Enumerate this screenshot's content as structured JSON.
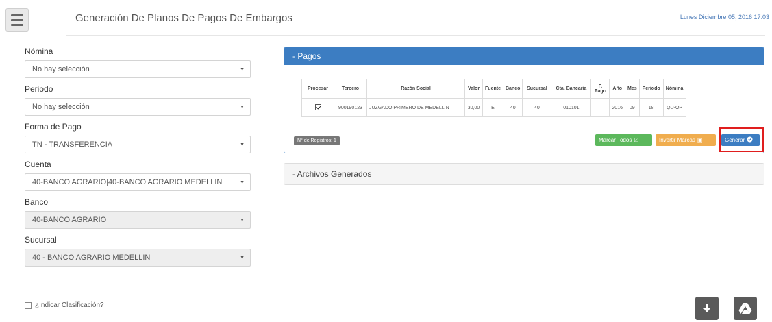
{
  "header": {
    "title": "Generación De Planos De Pagos De Embargos",
    "date": "Lunes Diciembre 05, 2016 17:03"
  },
  "form": {
    "nomina": {
      "label": "Nómina",
      "value": "No hay selección"
    },
    "periodo": {
      "label": "Periodo",
      "value": "No hay selección"
    },
    "forma_pago": {
      "label": "Forma de Pago",
      "value": "TN - TRANSFERENCIA"
    },
    "cuenta": {
      "label": "Cuenta",
      "value": "40-BANCO AGRARIO|40-BANCO AGRARIO MEDELLIN"
    },
    "banco": {
      "label": "Banco",
      "value": "40-BANCO AGRARIO"
    },
    "sucursal": {
      "label": "Sucursal",
      "value": "40 - BANCO AGRARIO MEDELLIN"
    },
    "clasificacion_label": "¿Indicar Clasificación?"
  },
  "pagos": {
    "heading": "- Pagos",
    "columns": [
      "Procesar",
      "Tercero",
      "Razón Social",
      "Valor",
      "Fuente",
      "Banco",
      "Sucursal",
      "Cta. Bancaria",
      "F. Pago",
      "Año",
      "Mes",
      "Periodo",
      "Nómina"
    ],
    "rows": [
      {
        "procesar": true,
        "tercero": "900190123",
        "razon_social": "JUZGADO PRIMERO DE MEDELLIN",
        "valor": "30,00",
        "fuente": "E",
        "banco": "40",
        "sucursal": "40",
        "cta_bancaria": "010101",
        "f_pago": "",
        "anio": "2016",
        "mes": "09",
        "periodo": "18",
        "nomina": "QU-OP"
      }
    ],
    "registros": "N° de Registros: 1",
    "buttons": {
      "marcar": "Marcar Todos",
      "invertir": "Invertir Marcas",
      "generar": "Generar"
    }
  },
  "archivos": {
    "heading": "- Archivos Generados"
  },
  "colors": {
    "primary": "#3c7dc2",
    "success": "#5cb85c",
    "warning": "#f0ad4e",
    "highlight": "#e01e1e"
  },
  "icons": [
    "menu-icon",
    "caret-down-icon",
    "check-square-icon",
    "check-circle-icon",
    "download-icon",
    "google-drive-icon"
  ]
}
